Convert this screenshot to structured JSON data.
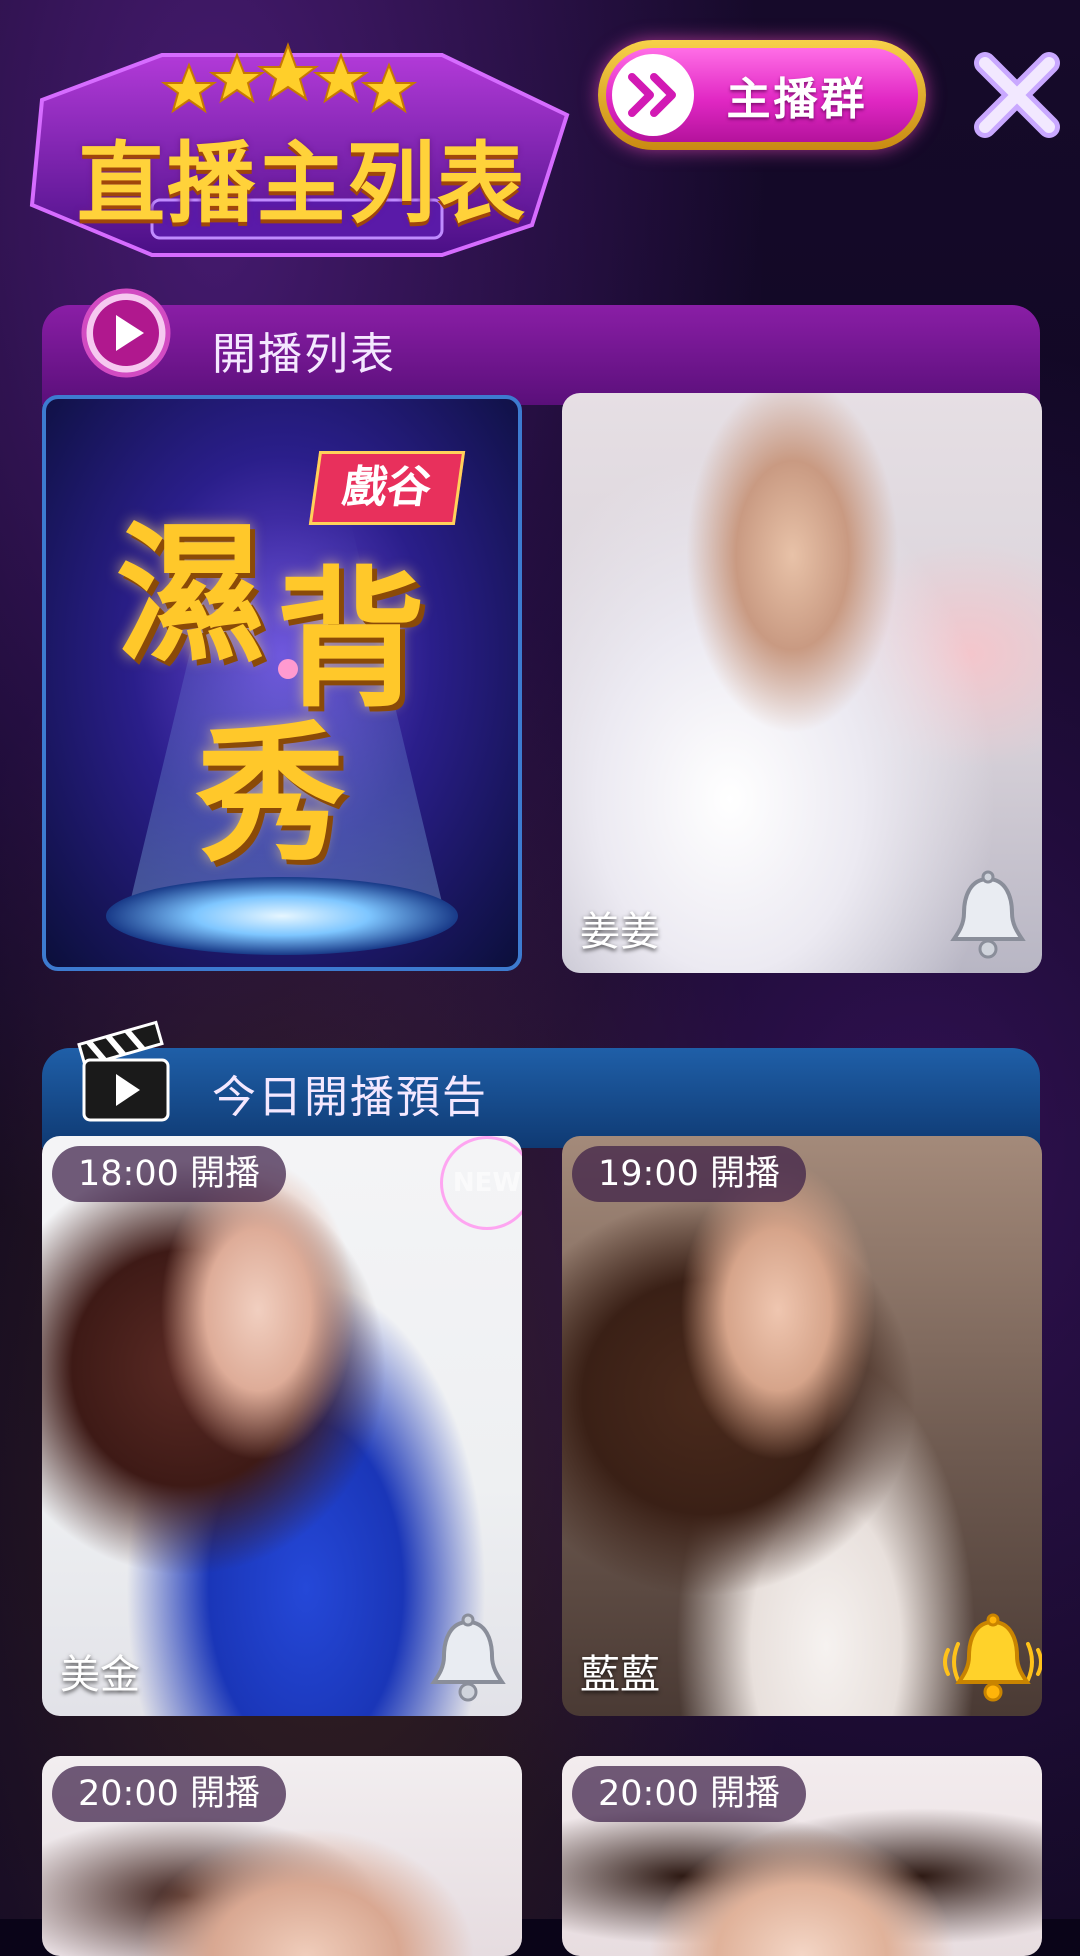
{
  "header": {
    "title": "直播主列表",
    "group_button": "主播群"
  },
  "live_section": {
    "title": "開播列表",
    "promo": {
      "brand": "戲谷",
      "title_char_1": "濕",
      "title_char_2": "背",
      "title_char_3": "秀"
    },
    "cards": [
      {
        "name": "姜姜",
        "bell": "silver-bell-icon"
      }
    ]
  },
  "preview_section": {
    "title": "今日開播預告",
    "cards": [
      {
        "time": "18:00 開播",
        "name": "美金",
        "new": "NEW",
        "bell": "silver-bell-icon"
      },
      {
        "time": "19:00 開播",
        "name": "藍藍",
        "bell": "gold-bell-icon"
      },
      {
        "time": "20:00 開播",
        "name": ""
      },
      {
        "time": "20:00 開播",
        "name": ""
      }
    ]
  },
  "colors": {
    "live_header": "#8a1ea6",
    "preview_header": "#1f5fa8",
    "accent_pink": "#e128c4",
    "accent_gold": "#f7d14a"
  }
}
